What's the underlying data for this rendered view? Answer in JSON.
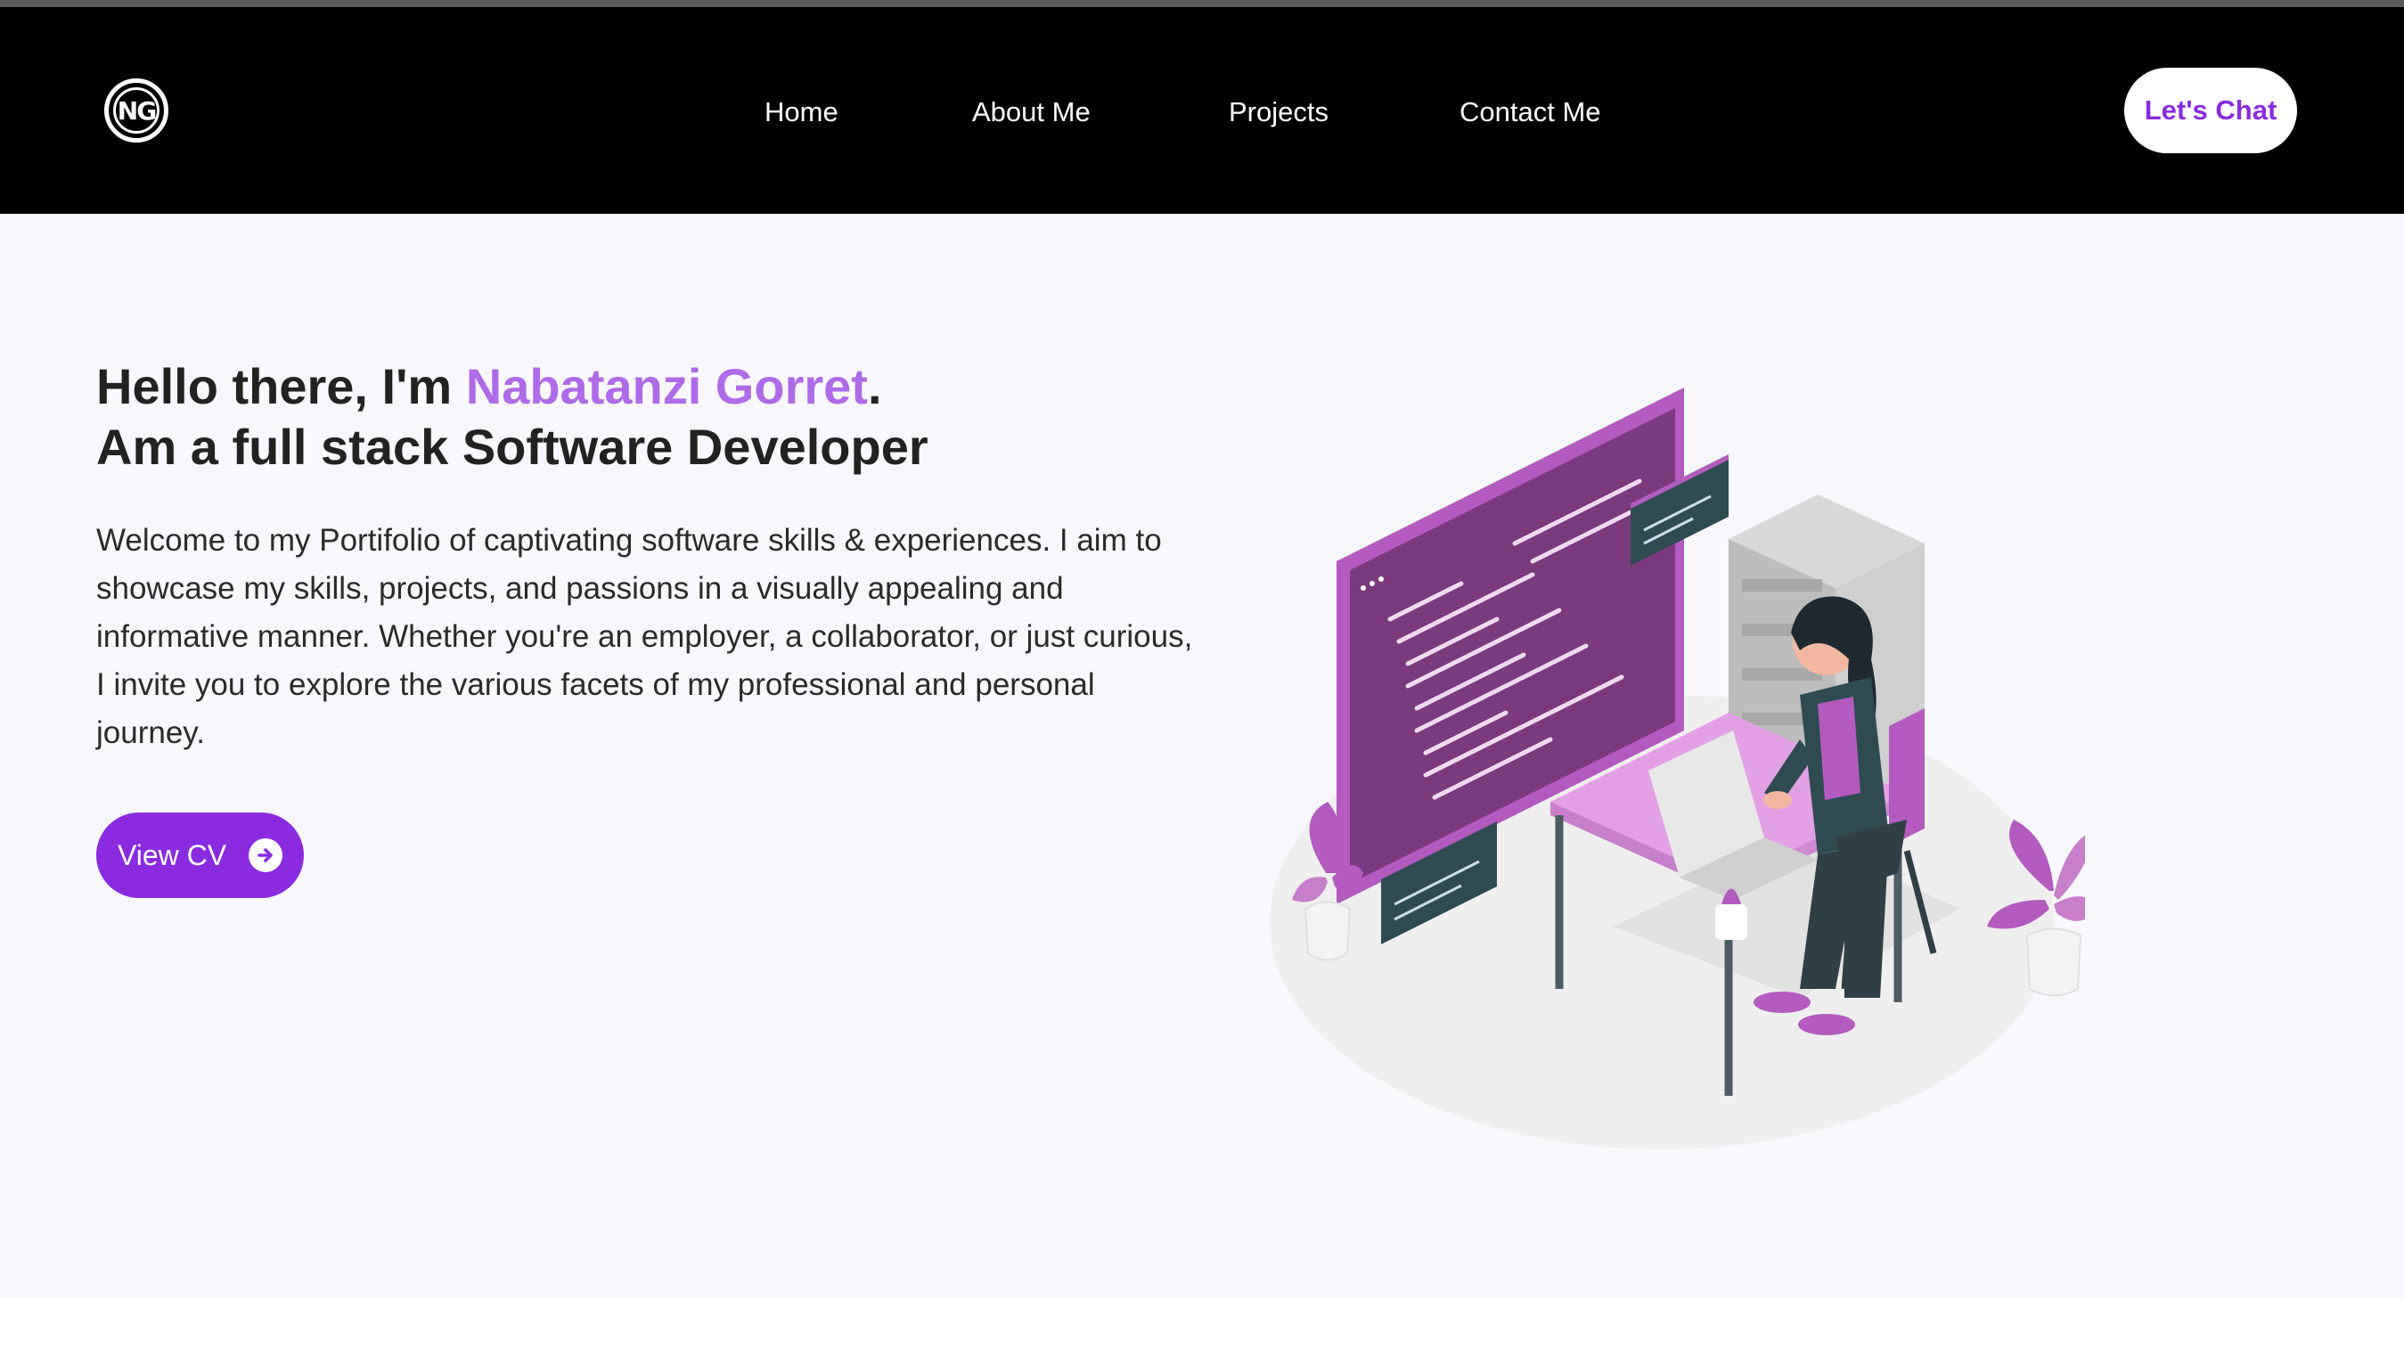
{
  "nav": {
    "logo_text": "NG",
    "links": [
      "Home",
      "About Me",
      "Projects",
      "Contact Me"
    ],
    "cta_label": "Let's Chat"
  },
  "hero": {
    "greeting_prefix": "Hello there, I'm ",
    "name": "Nabatanzi Gorret",
    "greeting_suffix": ".",
    "subtitle": "Am a full stack Software Developer",
    "intro": "Welcome to my Portifolio of captivating software skills & experiences. I aim to showcase my skills, projects, and passions in a visually appealing and informative manner. Whether you're an employer, a collaborator, or just curious, I invite you to explore the various facets of my professional and personal journey.",
    "cv_button_label": "View CV",
    "cv_button_icon": "arrow-right-circle-icon",
    "illustration": "developer-at-desk-illustration"
  },
  "colors": {
    "accent": "#8a2be2",
    "name_highlight": "#b06ae8",
    "nav_bg": "#000000",
    "hero_bg": "#f8f8fc"
  }
}
